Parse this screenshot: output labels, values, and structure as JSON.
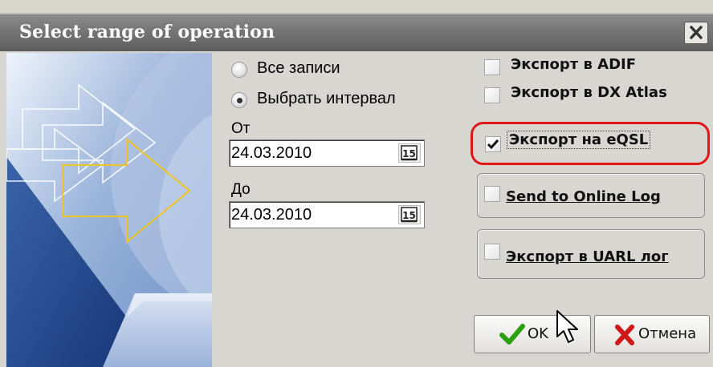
{
  "window": {
    "title": "Select range of operation"
  },
  "range": {
    "option_all": "Все записи",
    "option_interval": "Выбрать интервал",
    "selected": "interval",
    "from_label": "От",
    "from_value": "24.03.2010",
    "to_label": "До",
    "to_value": "24.03.2010",
    "calendar_icon_text": "15"
  },
  "exports": {
    "adif": {
      "label": "Экспорт в ADIF",
      "checked": false
    },
    "dxatlas": {
      "label": "Экспорт в DX Atlas",
      "checked": false
    },
    "eqsl": {
      "label": "Экспорт на eQSL",
      "checked": true
    },
    "online_log": {
      "label": "Send to Online Log",
      "checked": false
    },
    "uarl": {
      "label": "Экспорт в UARL лог",
      "checked": false
    }
  },
  "buttons": {
    "ok_label": "OK",
    "cancel_label": "Отмена"
  },
  "colors": {
    "highlight": "#e01818",
    "ok_check": "#2aa00f",
    "cancel_x": "#d01818"
  }
}
